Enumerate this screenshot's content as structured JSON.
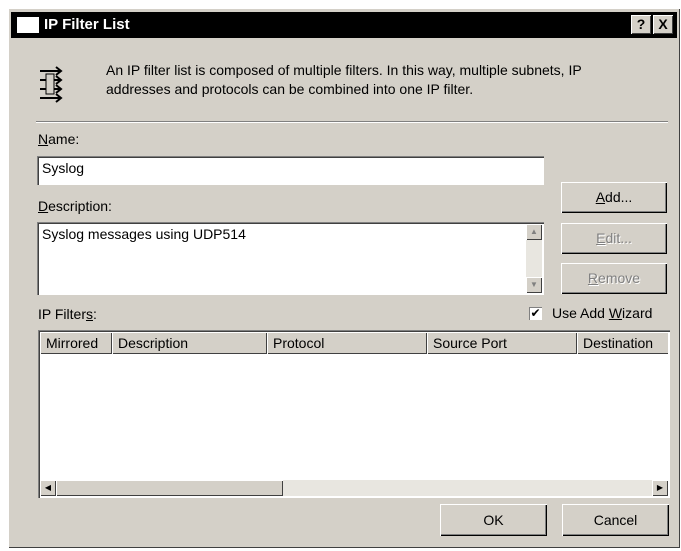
{
  "window": {
    "title": "IP Filter List",
    "help_button": "?",
    "close_button": "X"
  },
  "info_icon": "ip-filter-list-icon",
  "info_text": "An IP filter list is composed of multiple filters. In this way, multiple subnets, IP addresses and protocols can be combined into one IP filter.",
  "name": {
    "label_u": "N",
    "label_rest": "ame:",
    "value": "Syslog"
  },
  "description": {
    "label_u": "D",
    "label_rest": "escription:",
    "value": "Syslog messages using UDP514"
  },
  "buttons": {
    "add_u": "A",
    "add_rest": "dd...",
    "edit_u": "E",
    "edit_rest": "dit...",
    "remove_u": "R",
    "remove_rest": "emove",
    "ok": "OK",
    "cancel": "Cancel"
  },
  "use_add_wizard": {
    "label_pre": "Use Add ",
    "label_u": "W",
    "label_post": "izard",
    "checked": true
  },
  "ip_filters": {
    "label_pre": "IP Filter",
    "label_u": "s",
    "label_post": ":",
    "columns": [
      "Mirrored",
      "Description",
      "Protocol",
      "Source Port",
      "Destination"
    ],
    "rows": []
  }
}
